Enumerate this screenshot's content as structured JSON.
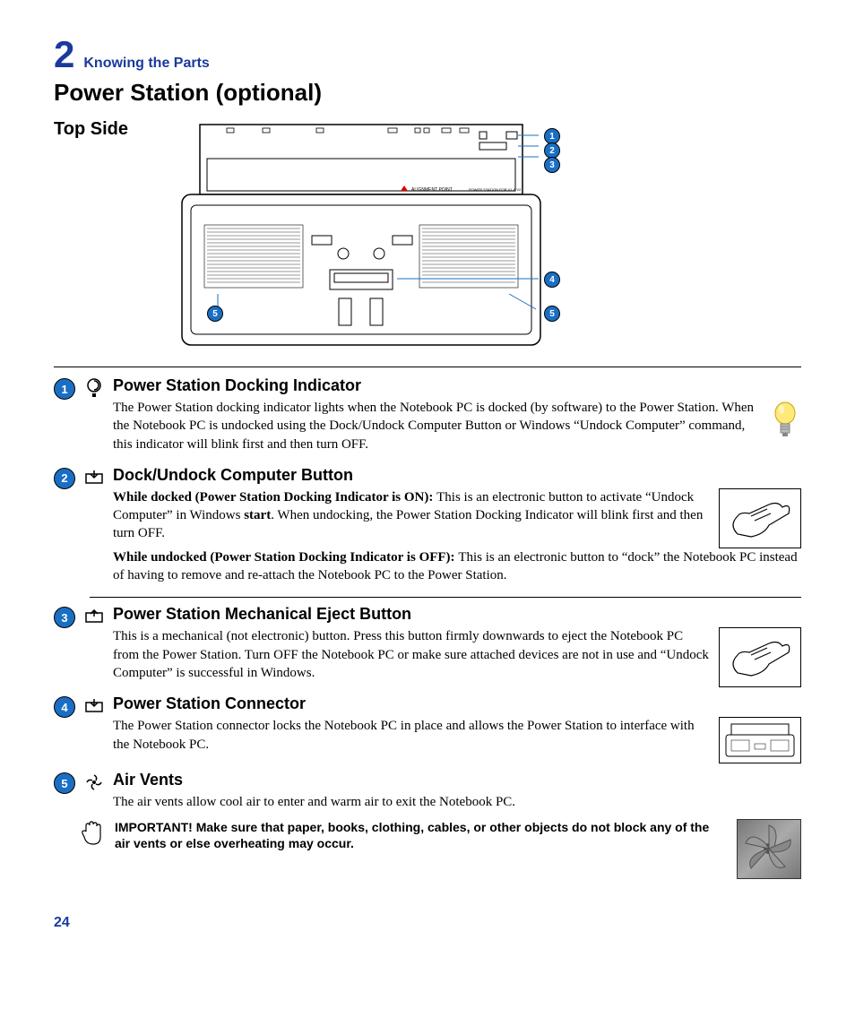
{
  "chapter": {
    "number": "2",
    "title": "Knowing the Parts"
  },
  "heading": "Power Station (optional)",
  "subheading": "Top Side",
  "diagram_label": "ALIGNMENT POINT",
  "diagram_label2": "POWER STATION FOR V1 & V2",
  "callouts": [
    "1",
    "2",
    "3",
    "4",
    "5",
    "5"
  ],
  "items": [
    {
      "num": "1",
      "title": "Power Station Docking Indicator",
      "paragraphs": [
        "The Power Station docking indicator lights when the Notebook PC is docked (by software) to the Power Station. When the Notebook PC is undocked using the Dock/Undock Computer Button or Windows “Undock Computer” command, this indicator will blink first and then turn OFF."
      ]
    },
    {
      "num": "2",
      "title": "Dock/Undock Computer Button",
      "p1_bold": "While docked (Power Station Docking Indicator is ON): ",
      "p1_rest_a": "This is an electronic button to activate “Undock Computer” in Windows ",
      "p1_bold_inner": "start",
      "p1_rest_b": ". When undocking, the Power Station Docking Indicator will blink first and then turn OFF.",
      "p2_bold": "While undocked (Power Station Docking Indicator is OFF): ",
      "p2_rest": "This is an electronic button to “dock” the Notebook PC instead of having to remove and re-attach the Notebook PC to the Power Station."
    },
    {
      "num": "3",
      "title": "Power Station Mechanical Eject Button",
      "paragraphs": [
        "This is a mechanical (not electronic) button. Press this button firmly downwards to eject the Notebook PC from the Power Station. Turn OFF the Notebook PC or make sure attached devices are not in use and “Undock Computer” is successful in Windows."
      ]
    },
    {
      "num": "4",
      "title": "Power Station Connector",
      "paragraphs": [
        "The Power Station connector locks the Notebook PC in place and allows the Power Station to interface with the Notebook PC."
      ]
    },
    {
      "num": "5",
      "title": "Air Vents",
      "paragraphs": [
        "The air vents allow cool air to enter and warm air to exit the Notebook PC."
      ]
    }
  ],
  "important": "IMPORTANT!  Make sure that paper, books, clothing, cables, or other objects do not block any of the air vents or else overheating may occur.",
  "page_number": "24"
}
